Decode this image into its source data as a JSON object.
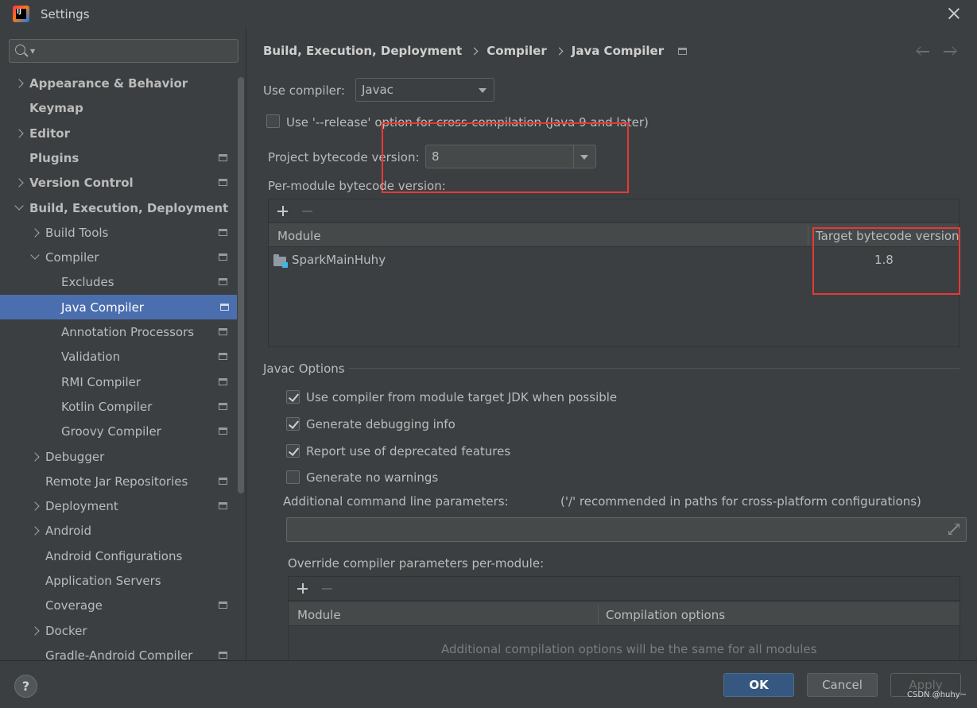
{
  "window": {
    "title": "Settings",
    "logo_text": "IJ"
  },
  "search": {
    "placeholder": ""
  },
  "sidebar": {
    "items": [
      {
        "label": "Appearance & Behavior",
        "level": 0,
        "bold": true,
        "expander": "right",
        "proj": false
      },
      {
        "label": "Keymap",
        "level": 0,
        "bold": true,
        "expander": "none",
        "proj": false
      },
      {
        "label": "Editor",
        "level": 0,
        "bold": true,
        "expander": "right",
        "proj": false
      },
      {
        "label": "Plugins",
        "level": 0,
        "bold": true,
        "expander": "none",
        "proj": true
      },
      {
        "label": "Version Control",
        "level": 0,
        "bold": true,
        "expander": "right",
        "proj": true
      },
      {
        "label": "Build, Execution, Deployment",
        "level": 0,
        "bold": true,
        "expander": "down",
        "proj": false
      },
      {
        "label": "Build Tools",
        "level": 1,
        "bold": false,
        "expander": "right",
        "proj": true
      },
      {
        "label": "Compiler",
        "level": 1,
        "bold": false,
        "expander": "down",
        "proj": true
      },
      {
        "label": "Excludes",
        "level": 2,
        "bold": false,
        "expander": "none",
        "proj": true
      },
      {
        "label": "Java Compiler",
        "level": 2,
        "bold": false,
        "expander": "none",
        "proj": true,
        "selected": true
      },
      {
        "label": "Annotation Processors",
        "level": 2,
        "bold": false,
        "expander": "none",
        "proj": true
      },
      {
        "label": "Validation",
        "level": 2,
        "bold": false,
        "expander": "none",
        "proj": true
      },
      {
        "label": "RMI Compiler",
        "level": 2,
        "bold": false,
        "expander": "none",
        "proj": true
      },
      {
        "label": "Kotlin Compiler",
        "level": 2,
        "bold": false,
        "expander": "none",
        "proj": true
      },
      {
        "label": "Groovy Compiler",
        "level": 2,
        "bold": false,
        "expander": "none",
        "proj": true
      },
      {
        "label": "Debugger",
        "level": 1,
        "bold": false,
        "expander": "right",
        "proj": false
      },
      {
        "label": "Remote Jar Repositories",
        "level": 1,
        "bold": false,
        "expander": "none",
        "proj": true
      },
      {
        "label": "Deployment",
        "level": 1,
        "bold": false,
        "expander": "right",
        "proj": true
      },
      {
        "label": "Android",
        "level": 1,
        "bold": false,
        "expander": "right",
        "proj": false
      },
      {
        "label": "Android Configurations",
        "level": 1,
        "bold": false,
        "expander": "none",
        "proj": false
      },
      {
        "label": "Application Servers",
        "level": 1,
        "bold": false,
        "expander": "none",
        "proj": false
      },
      {
        "label": "Coverage",
        "level": 1,
        "bold": false,
        "expander": "none",
        "proj": true
      },
      {
        "label": "Docker",
        "level": 1,
        "bold": false,
        "expander": "right",
        "proj": false
      },
      {
        "label": "Gradle-Android Compiler",
        "level": 1,
        "bold": false,
        "expander": "none",
        "proj": true
      }
    ]
  },
  "breadcrumb": [
    "Build, Execution, Deployment",
    "Compiler",
    "Java Compiler"
  ],
  "main": {
    "use_compiler_label": "Use compiler:",
    "use_compiler_value": "Javac",
    "release_option_label": "Use '--release' option for cross-compilation (Java 9 and later)",
    "release_option_checked": false,
    "project_bytecode_label": "Project bytecode version:",
    "project_bytecode_value": "8",
    "per_module_label": "Per-module bytecode version:",
    "module_table": {
      "columns": [
        "Module",
        "Target bytecode version"
      ],
      "rows": [
        {
          "module": "SparkMainHuhy",
          "target": "1.8"
        }
      ]
    },
    "javac_options_title": "Javac Options",
    "options": [
      {
        "label": "Use compiler from module target JDK when possible",
        "checked": true
      },
      {
        "label": "Generate debugging info",
        "checked": true
      },
      {
        "label": "Report use of deprecated features",
        "checked": true
      },
      {
        "label": "Generate no warnings",
        "checked": false
      }
    ],
    "additional_params_label": "Additional command line parameters:",
    "additional_params_hint": "('/' recommended in paths for cross-platform configurations)",
    "additional_params_value": "",
    "override_label": "Override compiler parameters per-module:",
    "override_table": {
      "columns": [
        "Module",
        "Compilation options"
      ],
      "empty_text": "Additional compilation options will be the same for all modules"
    }
  },
  "footer": {
    "help": "?",
    "ok": "OK",
    "cancel": "Cancel",
    "apply": "Apply",
    "watermark": "CSDN @huhy~"
  },
  "colors": {
    "selection": "#4b6eaf",
    "annotation_box": "#e53935",
    "primary_button": "#365880"
  }
}
